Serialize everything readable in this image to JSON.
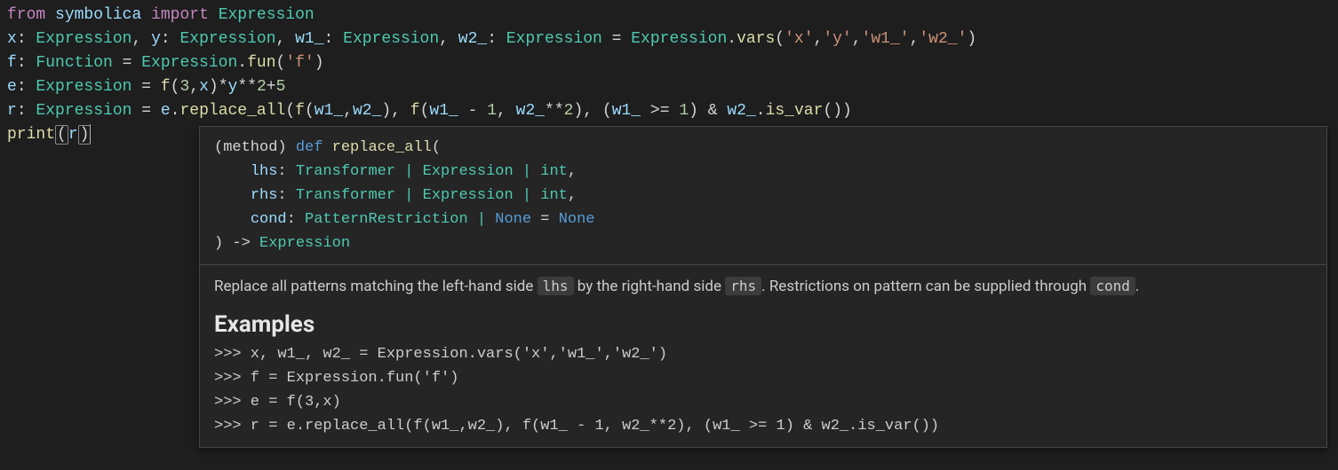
{
  "code": {
    "line1": {
      "kw1": "from",
      "mod": "symbolica",
      "kw2": "import",
      "name": "Expression"
    },
    "line2": {
      "v1": "x",
      "t1": "Expression",
      "v2": "y",
      "t2": "Expression",
      "v3": "w1_",
      "t3": "Expression",
      "v4": "w2_",
      "t4": "Expression",
      "rhs_obj": "Expression",
      "rhs_fn": "vars",
      "s1": "'x'",
      "s2": "'y'",
      "s3": "'w1_'",
      "s4": "'w2_'"
    },
    "line3": {
      "v": "f",
      "t": "Function",
      "obj": "Expression",
      "fn": "fun",
      "s": "'f'"
    },
    "line4": {
      "v": "e",
      "t": "Expression",
      "call": "f",
      "n1": "3",
      "arg2": "x",
      "var_y": "y",
      "n2": "2",
      "n3": "5"
    },
    "line5": {
      "v": "r",
      "t": "Expression",
      "obj": "e",
      "fn": "replace_all",
      "f1": "f",
      "a1": "w1_",
      "a2": "w2_",
      "f2": "f",
      "b1": "w1_",
      "b1n": "1",
      "b2": "w2_",
      "b2n": "2",
      "c1": "w1_",
      "c1n": "1",
      "c2": "w2_",
      "c2fn": "is_var"
    },
    "line6": {
      "fn": "print",
      "arg": "r"
    }
  },
  "tooltip": {
    "sig": {
      "prefix": "(method) ",
      "def": "def",
      "name": "replace_all",
      "p1": "lhs",
      "p1t": "Transformer | Expression | int",
      "p2": "rhs",
      "p2t": "Transformer | Expression | int",
      "p3": "cond",
      "p3t": "PatternRestriction | ",
      "p3t_none": "None",
      "p3d": "None",
      "ret": "Expression"
    },
    "doc": {
      "t1": "Replace all patterns matching the left-hand side ",
      "c1": "lhs",
      "t2": " by the right-hand side ",
      "c2": "rhs",
      "t3": ". Restrictions on pattern can be supplied through ",
      "c3": "cond",
      "t4": "."
    },
    "examples_heading": "Examples",
    "examples": {
      "l1": ">>> x, w1_, w2_ = Expression.vars('x','w1_','w2_')",
      "l2": ">>> f = Expression.fun('f')",
      "l3": ">>> e = f(3,x)",
      "l4": ">>> r = e.replace_all(f(w1_,w2_), f(w1_ - 1, w2_**2), (w1_ >= 1) & w2_.is_var())"
    }
  }
}
